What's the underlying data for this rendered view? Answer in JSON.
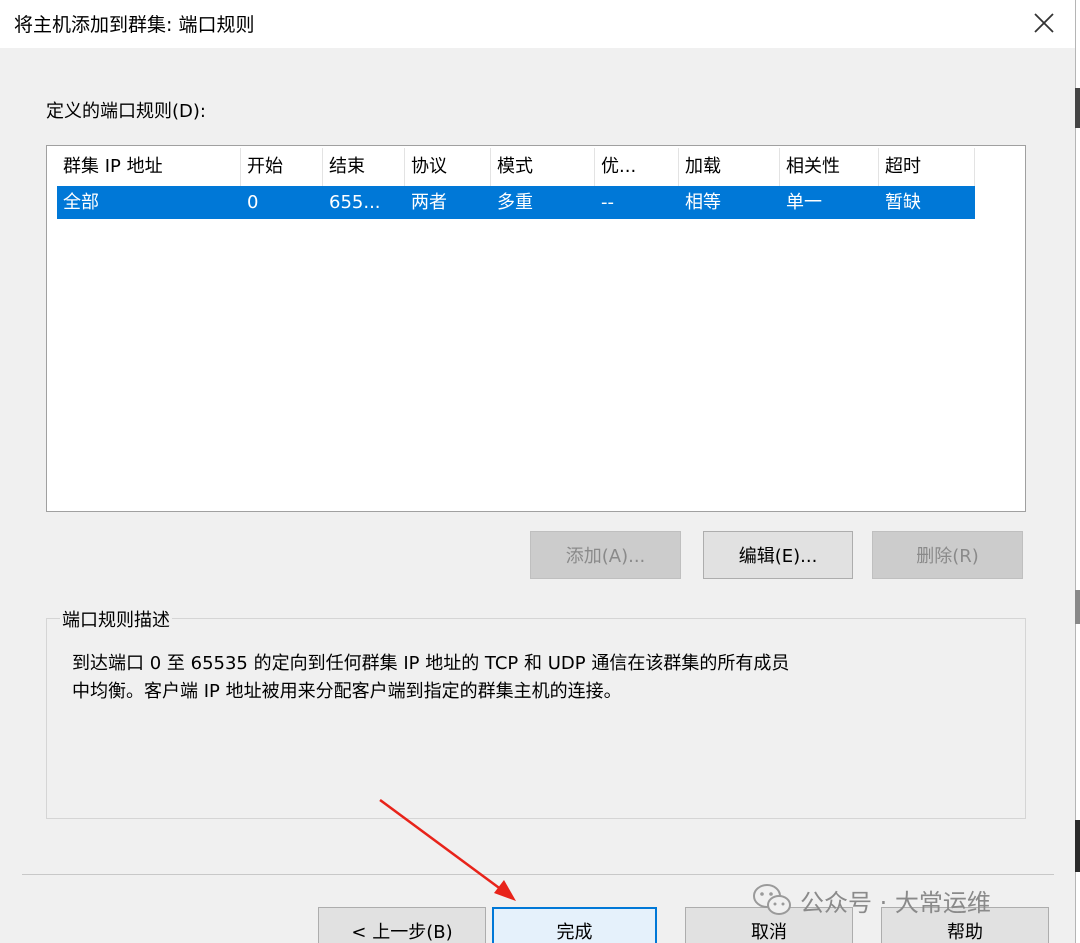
{
  "window": {
    "title": "将主机添加到群集: 端口规则"
  },
  "rules": {
    "label": "定义的端口规则(D):",
    "columns": [
      "群集 IP 地址",
      "开始",
      "结束",
      "协议",
      "模式",
      "优...",
      "加载",
      "相关性",
      "超时"
    ],
    "rows": [
      [
        "全部",
        "0",
        "655...",
        "两者",
        "多重",
        "--",
        "相等",
        "单一",
        "暂缺"
      ]
    ]
  },
  "actions": {
    "add": "添加(A)...",
    "edit": "编辑(E)...",
    "delete": "删除(R)"
  },
  "description": {
    "title": "端口规则描述",
    "line1": "到达端口 0 至 65535 的定向到任何群集 IP 地址的 TCP 和 UDP 通信在该群集的所有成员",
    "line2": "中均衡。客户端 IP 地址被用来分配客户端到指定的群集主机的连接。"
  },
  "footer": {
    "back": "< 上一步(B)",
    "finish": "完成",
    "cancel": "取消",
    "help": "帮助"
  },
  "watermark": {
    "text": "公众号 · 大常运维"
  },
  "colors": {
    "selection": "#0078d7",
    "annotation_arrow": "#e8231a"
  }
}
